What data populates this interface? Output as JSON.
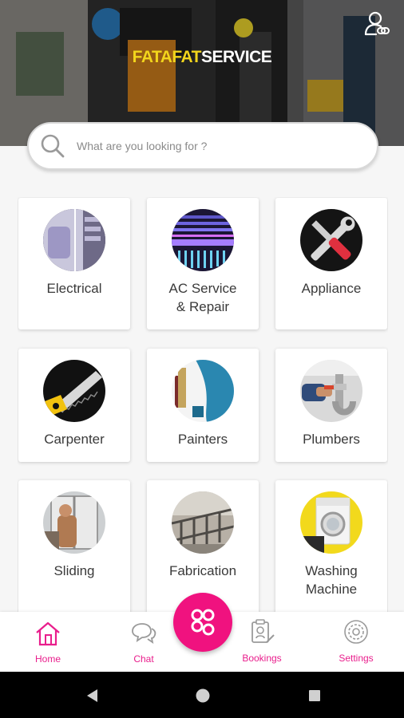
{
  "app": {
    "brand_part1": "FATAFAT",
    "brand_part2": "SERVICE"
  },
  "search": {
    "placeholder": "What are you looking for ?"
  },
  "services": [
    {
      "label_line1": "Electrical",
      "label_line2": "",
      "icon": "electrical-panel-icon"
    },
    {
      "label_line1": "AC Service",
      "label_line2": "& Repair",
      "icon": "air-conditioner-icon"
    },
    {
      "label_line1": "Appliance",
      "label_line2": "",
      "icon": "wrench-screwdriver-icon"
    },
    {
      "label_line1": "Carpenter",
      "label_line2": "",
      "icon": "saw-icon"
    },
    {
      "label_line1": "Painters",
      "label_line2": "",
      "icon": "paint-icon"
    },
    {
      "label_line1": "Plumbers",
      "label_line2": "",
      "icon": "pipe-icon"
    },
    {
      "label_line1": "Sliding",
      "label_line2": "",
      "icon": "sliding-window-icon"
    },
    {
      "label_line1": "Fabrication",
      "label_line2": "",
      "icon": "railing-icon"
    },
    {
      "label_line1": "Washing",
      "label_line2": "Machine",
      "icon": "washing-machine-icon"
    }
  ],
  "nav": {
    "home": "Home",
    "chat": "Chat",
    "bookings": "Bookings",
    "settings": "Settings"
  },
  "colors": {
    "accent": "#e91e8c",
    "fab": "#f0127f",
    "brand_yellow": "#f2d51c"
  }
}
